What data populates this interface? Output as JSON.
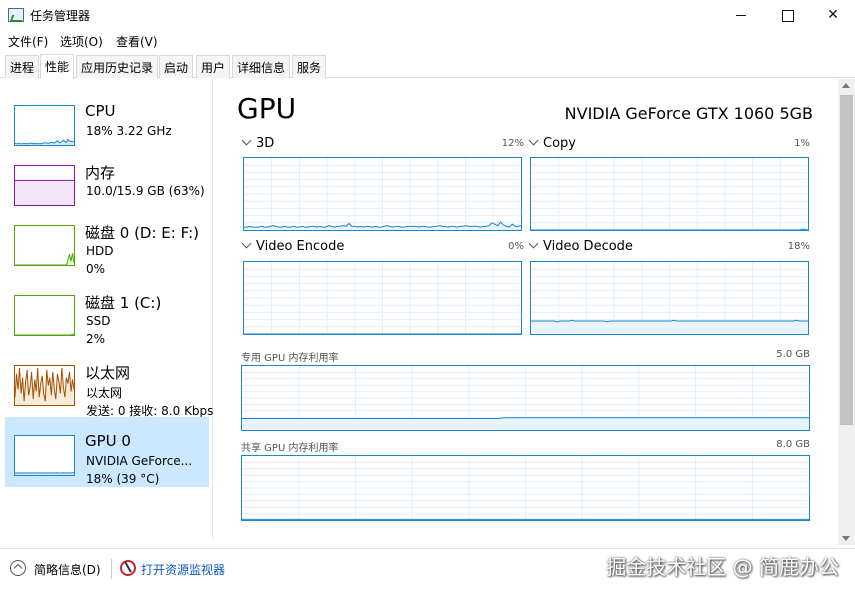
{
  "window": {
    "title": "任务管理器"
  },
  "menu": [
    "文件(F)",
    "选项(O)",
    "查看(V)"
  ],
  "tabs": [
    "进程",
    "性能",
    "应用历史记录",
    "启动",
    "用户",
    "详细信息",
    "服务"
  ],
  "active_tab": "性能",
  "resources": [
    {
      "name": "CPU",
      "line1": "18% 3.22 GHz",
      "line2": "",
      "color": "#1a88c9",
      "fill": "#d4e8f6",
      "series": [
        4,
        3,
        3,
        4,
        3,
        3,
        4,
        3,
        4,
        3,
        4,
        5,
        3,
        4,
        3,
        4,
        3,
        3,
        4,
        5,
        6,
        5,
        4,
        5,
        7,
        6,
        5,
        8,
        11,
        7,
        6,
        9,
        12,
        8,
        7,
        14,
        10,
        9,
        8,
        10
      ]
    },
    {
      "name": "内存",
      "line1": "10.0/15.9 GB (63%)",
      "line2": "",
      "color": "#8b12ae",
      "fill": "#f1e6f5",
      "series": [
        63,
        63,
        63,
        63,
        63,
        63,
        63,
        63,
        63,
        63,
        63,
        63,
        63,
        63,
        63,
        63,
        63,
        63,
        63,
        63,
        63,
        63,
        63,
        63,
        63,
        63,
        63,
        63,
        63,
        63,
        63,
        63,
        63,
        63,
        63,
        63,
        63,
        63,
        63,
        63
      ]
    },
    {
      "name": "磁盘 0 (D: E: F:)",
      "line1": "HDD",
      "line2": "0%",
      "color": "#4da60c",
      "fill": "#e5f4d9",
      "series": [
        0,
        0,
        0,
        0,
        0,
        0,
        0,
        0,
        0,
        0,
        0,
        0,
        0,
        0,
        0,
        0,
        0,
        0,
        0,
        0,
        0,
        0,
        0,
        0,
        0,
        0,
        0,
        0,
        0,
        0,
        0,
        0,
        0,
        0,
        0,
        12,
        28,
        10,
        30,
        5
      ]
    },
    {
      "name": "磁盘 1 (C:)",
      "line1": "SSD",
      "line2": "2%",
      "color": "#4da60c",
      "fill": "#e5f4d9",
      "series": [
        0,
        0,
        0,
        0,
        0,
        0,
        0,
        0,
        0,
        0,
        0,
        0,
        0,
        0,
        0,
        0,
        0,
        0,
        0,
        0,
        0,
        0,
        0,
        0,
        0,
        0,
        0,
        0,
        0,
        0,
        0,
        0,
        0,
        0,
        0,
        0,
        0,
        0,
        2,
        2
      ]
    },
    {
      "name": "以太网",
      "line1": "以太网",
      "line2": "发送: 0 接收: 8.0 Kbps",
      "color": "#a74f01",
      "fill": "#f6ead9",
      "series": [
        20,
        80,
        40,
        95,
        30,
        70,
        10,
        60,
        90,
        25,
        45,
        85,
        15,
        65,
        35,
        95,
        20,
        55,
        75,
        30,
        10,
        90,
        50,
        70,
        25,
        85,
        40,
        15,
        80,
        60,
        30,
        95,
        45,
        20,
        70,
        55,
        85,
        35,
        65,
        40
      ]
    },
    {
      "name": "GPU 0",
      "line1": "NVIDIA GeForce...",
      "line2": "18% (39 °C)",
      "color": "#1a88c9",
      "fill": "#d4e8f6",
      "series": [
        5,
        5,
        6,
        5,
        5,
        5,
        6,
        5,
        5,
        6,
        5,
        5,
        5,
        6,
        5,
        5,
        5,
        5,
        6,
        5,
        5,
        6,
        5,
        5,
        5,
        6,
        5,
        5,
        6,
        5,
        5,
        5,
        6,
        5,
        6,
        5,
        5,
        6,
        5,
        7
      ]
    }
  ],
  "gpu": {
    "title": "GPU",
    "model": "NVIDIA GeForce GTX 1060 5GB",
    "graphs": [
      {
        "label": "3D",
        "pct": "12%",
        "series": [
          4,
          4,
          5,
          4,
          4,
          4,
          5,
          4,
          4,
          5,
          6,
          5,
          4,
          4,
          5,
          4,
          4,
          5,
          4,
          4,
          5,
          4,
          4,
          5,
          5,
          4,
          5,
          4,
          4,
          6,
          5,
          4,
          5,
          5,
          6,
          5,
          9,
          5,
          5,
          4,
          5,
          4,
          5,
          5,
          4,
          5,
          4,
          4,
          5,
          6,
          5,
          4,
          5,
          5,
          4,
          4,
          5,
          5,
          5,
          5,
          4,
          5,
          5,
          4,
          4,
          5,
          5,
          6,
          5,
          5,
          4,
          5,
          5,
          4,
          5,
          5,
          6,
          5,
          5,
          5,
          5,
          4,
          5,
          5,
          6,
          10,
          8,
          6,
          11,
          7,
          5,
          4,
          8,
          5,
          5,
          6
        ]
      },
      {
        "label": "Copy",
        "pct": "1%",
        "series": [
          0,
          0,
          0,
          0,
          0,
          0,
          0,
          0,
          0,
          0,
          0,
          0,
          0,
          0,
          0,
          0,
          0,
          0,
          0,
          0,
          0,
          0,
          0,
          0,
          0,
          0,
          0,
          0,
          0,
          0,
          0,
          0,
          0,
          0,
          0,
          0,
          0,
          0,
          0,
          0,
          0,
          0,
          0,
          0,
          0,
          0,
          0,
          0,
          0,
          0,
          0,
          0,
          0,
          0,
          0,
          0,
          0,
          0,
          0,
          0,
          0,
          0,
          0,
          0,
          0,
          0,
          0,
          0,
          0,
          0,
          0,
          0,
          0,
          0,
          0,
          0,
          0,
          0,
          0,
          0,
          0,
          0,
          0,
          0,
          0,
          0,
          0,
          0,
          0,
          0,
          0,
          0,
          0,
          1,
          1,
          0
        ]
      },
      {
        "label": "Video Encode",
        "pct": "0%",
        "series": [
          0,
          0,
          0,
          0,
          0,
          0,
          0,
          0,
          0,
          0,
          0,
          0,
          0,
          0,
          0,
          0,
          0,
          0,
          0,
          0,
          0,
          0,
          0,
          0,
          0,
          0,
          0,
          0,
          0,
          0,
          0,
          0,
          0,
          0,
          0,
          0,
          0,
          0,
          0,
          0,
          0,
          0,
          0,
          0,
          0,
          0,
          0,
          0,
          0,
          0,
          0,
          0,
          0,
          0,
          0,
          0,
          0,
          0,
          0,
          0,
          0,
          0,
          0,
          0,
          0,
          0,
          0,
          0,
          0,
          0,
          0,
          0,
          0,
          0,
          0,
          0,
          0,
          0,
          0,
          0,
          0,
          0,
          0,
          0,
          0,
          0,
          0,
          0,
          0,
          0,
          0,
          0,
          0,
          0,
          0,
          0
        ]
      },
      {
        "label": "Video Decode",
        "pct": "18%",
        "series": [
          18,
          18,
          18,
          18,
          18,
          18,
          18,
          18,
          18,
          17,
          18,
          18,
          18,
          18,
          19,
          18,
          18,
          18,
          18,
          18,
          18,
          18,
          18,
          18,
          18,
          18,
          17,
          18,
          18,
          18,
          18,
          18,
          18,
          18,
          18,
          18,
          18,
          18,
          18,
          18,
          18,
          18,
          18,
          18,
          18,
          18,
          18,
          18,
          18,
          19,
          18,
          18,
          18,
          18,
          18,
          18,
          18,
          18,
          18,
          18,
          18,
          18,
          18,
          18,
          18,
          18,
          18,
          18,
          18,
          18,
          18,
          18,
          18,
          18,
          18,
          18,
          18,
          18,
          18,
          18,
          18,
          18,
          18,
          18,
          18,
          18,
          18,
          18,
          18,
          18,
          18,
          19,
          18,
          18,
          18,
          18
        ]
      }
    ],
    "dedicated": {
      "label": "专用 GPU 内存利用率",
      "max": "5.0 GB",
      "series": [
        18,
        18,
        18,
        18,
        18,
        18,
        18,
        18,
        18,
        18,
        18,
        18,
        18,
        18,
        18,
        18,
        18,
        18,
        18,
        18,
        18,
        18,
        18,
        18,
        18,
        18,
        18,
        18,
        18,
        18,
        18,
        18,
        18,
        18,
        18,
        18,
        18,
        18,
        18,
        18,
        18,
        18,
        18,
        18,
        19,
        19,
        19,
        19,
        19,
        19,
        19,
        19,
        19,
        19,
        19,
        19,
        19,
        19,
        19,
        19,
        19,
        19,
        19,
        19,
        19,
        19,
        19,
        19,
        19,
        19,
        19,
        19,
        19,
        19,
        19,
        19,
        19,
        19,
        19,
        19,
        19,
        19,
        19,
        19,
        19,
        19,
        19,
        19,
        19,
        19,
        19,
        19,
        19,
        19,
        19,
        19
      ]
    },
    "shared": {
      "label": "共享 GPU 内存利用率",
      "max": "8.0 GB",
      "series": [
        1,
        1,
        1,
        1,
        1,
        1,
        1,
        1,
        1,
        1,
        1,
        1,
        1,
        1,
        1,
        1,
        1,
        1,
        1,
        1,
        1,
        1,
        1,
        1,
        1,
        1,
        1,
        1,
        1,
        1,
        1,
        1,
        1,
        1,
        1,
        1,
        1,
        1,
        1,
        1,
        1,
        1,
        1,
        1,
        1,
        1,
        1,
        1,
        1,
        1,
        1,
        1,
        1,
        1,
        1,
        1,
        1,
        1,
        1,
        1,
        1,
        1,
        1,
        1,
        1,
        1,
        1,
        1,
        1,
        1,
        1,
        1,
        1,
        1,
        1,
        1,
        1,
        1,
        1,
        1,
        1,
        1,
        1,
        1,
        1,
        1,
        1,
        1,
        1,
        1,
        1,
        1,
        1,
        1,
        1,
        1
      ]
    }
  },
  "footer": {
    "fewer_details": "简略信息(D)",
    "open_resmon": "打开资源监视器"
  },
  "watermark": "掘金技术社区 @ 简鹿办公"
}
